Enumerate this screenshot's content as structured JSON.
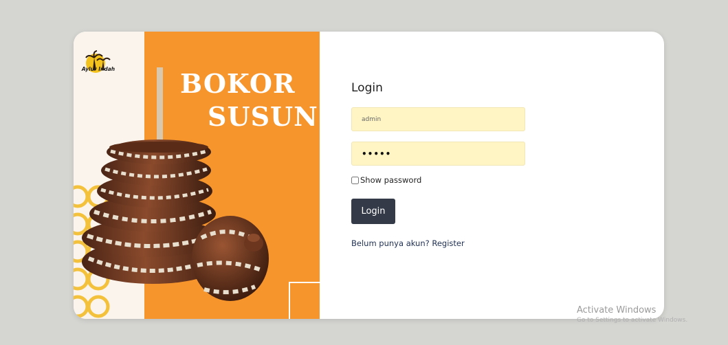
{
  "brand": {
    "logo_text": "Aylur Indah",
    "hero_line1": "BOKOR",
    "hero_line2": "SUSUN"
  },
  "login": {
    "title": "Login",
    "username_value": "admin",
    "password_value": "•••••",
    "show_password_label": "Show password",
    "show_password_checked": false,
    "submit_label": "Login",
    "register_text": "Belum punya akun? Register"
  },
  "watermark": {
    "line1": "Activate Windows",
    "line2": "Go to Settings to activate Windows."
  },
  "colors": {
    "accent_orange": "#f7952d",
    "input_bg": "#fff5c4",
    "button_bg": "#343a47",
    "page_bg": "#d5d5d2"
  },
  "icons": [
    "logo-palm-icon",
    "checkbox-icon"
  ]
}
